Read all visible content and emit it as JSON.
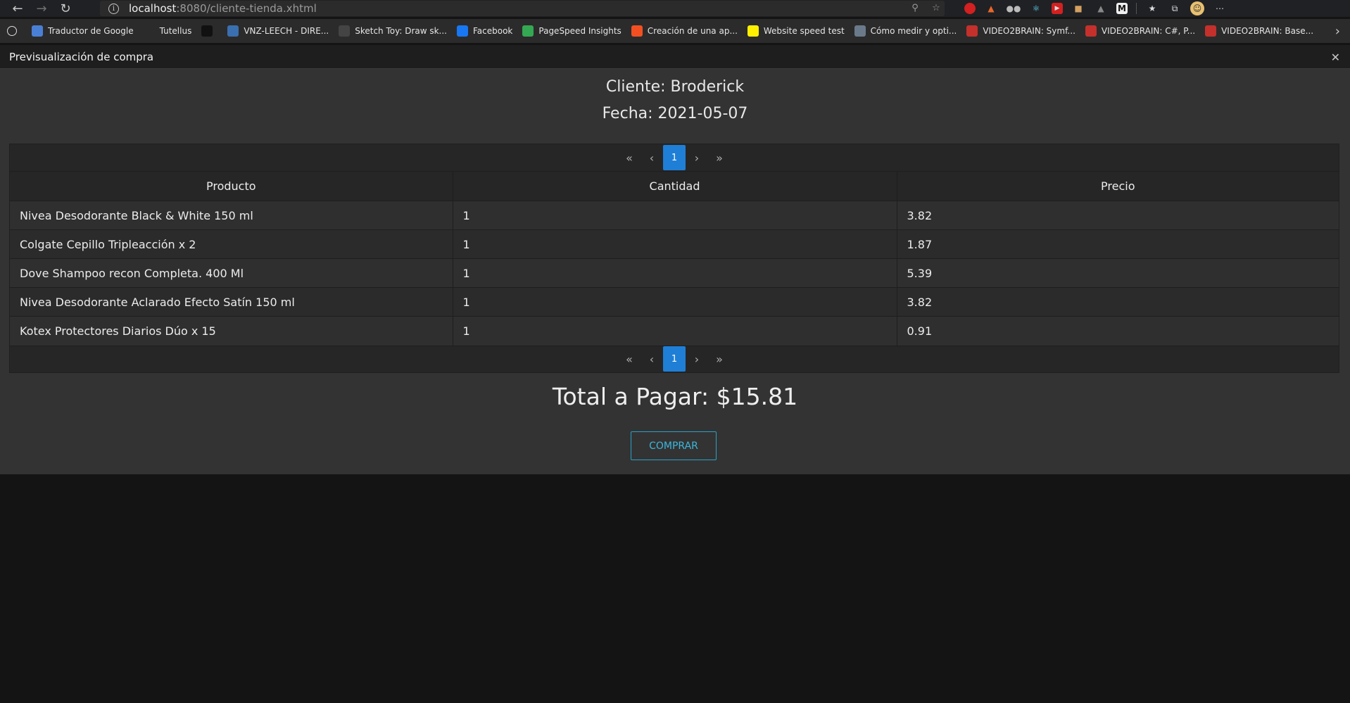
{
  "browser": {
    "url_host": "localhost",
    "url_path": ":8080/cliente-tienda.xhtml",
    "bookmarks": [
      {
        "label": "Traductor de Google",
        "icon": "google-translate-icon",
        "color": "#4a7fd6"
      },
      {
        "label": "Tutellus",
        "icon": "tutellus-icon",
        "color": "#2b2b2b"
      },
      {
        "label": "",
        "icon": "p-icon",
        "color": "#111111"
      },
      {
        "label": "VNZ-LEECH - DIRE...",
        "icon": "vnz-icon",
        "color": "#3a6fb0"
      },
      {
        "label": "Sketch Toy: Draw sk...",
        "icon": "sketch-icon",
        "color": "#444444"
      },
      {
        "label": "Facebook",
        "icon": "facebook-icon",
        "color": "#1877f2"
      },
      {
        "label": "PageSpeed Insights",
        "icon": "pagespeed-icon",
        "color": "#34a853"
      },
      {
        "label": "Creación de una ap...",
        "icon": "microsoft-icon",
        "color": "#f25022"
      },
      {
        "label": "Website speed test",
        "icon": "pingdom-icon",
        "color": "#fff000"
      },
      {
        "label": "Cómo medir y opti...",
        "icon": "article-icon",
        "color": "#6a7a8a"
      },
      {
        "label": "VIDEO2BRAIN: Symf...",
        "icon": "video2brain-icon",
        "color": "#c4302b"
      },
      {
        "label": "VIDEO2BRAIN: C#, P...",
        "icon": "video2brain-icon",
        "color": "#c4302b"
      },
      {
        "label": "VIDEO2BRAIN: Base...",
        "icon": "video2brain-icon",
        "color": "#c4302b"
      }
    ]
  },
  "dialog": {
    "title": "Previsualización de compra",
    "customer": "Cliente: Broderick",
    "date": "Fecha: 2021-05-07",
    "paginator_current": "1",
    "columns": [
      "Producto",
      "Cantidad",
      "Precio"
    ],
    "rows": [
      [
        "Nivea Desodorante Black & White 150 ml",
        "1",
        "3.82"
      ],
      [
        "Colgate Cepillo Tripleacción x 2",
        "1",
        "1.87"
      ],
      [
        "Dove Shampoo recon Completa. 400 Ml",
        "1",
        "5.39"
      ],
      [
        "Nivea Desodorante Aclarado Efecto Satín 150 ml",
        "1",
        "3.82"
      ],
      [
        "Kotex Protectores Diarios Dúo x 15",
        "1",
        "0.91"
      ]
    ],
    "total": "Total a Pagar: $15.81",
    "buy_label": "COMPRAR"
  }
}
